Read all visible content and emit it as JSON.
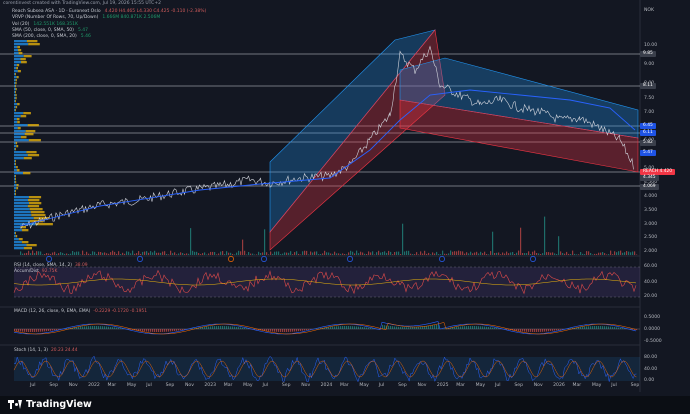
{
  "header": {
    "caption": "corentinvest created with TradingView.com, Jul 19, 2026 15:55 UTC+2"
  },
  "legend": {
    "line1": "Reach Subsea ASA · 1D · Euronext Oslo",
    "line1_values": "4.420  H4.465  L4.330  C4.425  -0.110 (-2.38%)",
    "line2": "VRVP (Number Of Rows, 70, Up/Down)",
    "line2_values": "1.666M  840.871K  2.506M",
    "line3": "Vol (20)",
    "line3_values": "142.551K  168.351K",
    "line4": "SMA (50, close, 0, SMA, 50)",
    "line4_values": "5.47",
    "line5": "SMA (200, close, 0, SMA, 20)",
    "line5_values": "5.46"
  },
  "price_axis": {
    "currency": "NOK",
    "ticks": [
      "10.00",
      "9.00",
      "8.00",
      "7.50",
      "7.00",
      "6.50",
      "6.00",
      "5.50",
      "5.00",
      "4.500",
      "4.000",
      "3.500",
      "3.000",
      "2.500",
      "2.000",
      "1.500"
    ],
    "tags": [
      {
        "label": "9.85",
        "color": "#3a3f4b"
      },
      {
        "label": "8.11",
        "color": "#3a3f4b"
      },
      {
        "label": "6.45",
        "color": "#1e53e5"
      },
      {
        "label": "6.11",
        "color": "#1e53e5"
      },
      {
        "label": "5.82",
        "color": "#3a3f4b"
      },
      {
        "label": "5.47",
        "color": "#1e53e5"
      },
      {
        "label": "REACH 4.420",
        "color": "#f23645"
      },
      {
        "label": "4.345",
        "color": "#3a3f4b"
      },
      {
        "label": "4.069",
        "color": "#3a3f4b"
      }
    ]
  },
  "rsi": {
    "label": "RSI (14, close, SMA, 14, 2)",
    "values": "38.09",
    "sublabel": "Accum/Dist",
    "sub_values": "92.75K",
    "axis": [
      "60.00",
      "40.00",
      "20.00"
    ]
  },
  "macd": {
    "label": "MACD (12, 26, close, 9, EMA, EMA)",
    "values": "-0.2229  -0.1720  -0.1951",
    "axis": [
      "0.5000",
      "0.0000",
      "-0.5000"
    ]
  },
  "stoch": {
    "label": "Stoch (14, 1, 3)",
    "values": "20.23  24.44",
    "axis": [
      "80.00",
      "40.00",
      "0.00"
    ]
  },
  "time_axis": [
    "Jul",
    "Sep",
    "Nov",
    "2022",
    "Mar",
    "May",
    "Jul",
    "Sep",
    "Nov",
    "2023",
    "Mar",
    "May",
    "Jul",
    "Sep",
    "Nov",
    "2024",
    "Mar",
    "May",
    "Jul",
    "Sep",
    "Nov",
    "2025",
    "Mar",
    "May",
    "Jul",
    "Sep",
    "Nov",
    "2026",
    "Mar",
    "May",
    "Jul",
    "Sep"
  ],
  "footer": {
    "brand": "TradingView"
  },
  "colors": {
    "background": "#131722",
    "channel_blue": "#2196f3",
    "channel_red": "#f23645",
    "sma_blue": "#2962ff",
    "rsi_purple": "#7e57c2"
  }
}
